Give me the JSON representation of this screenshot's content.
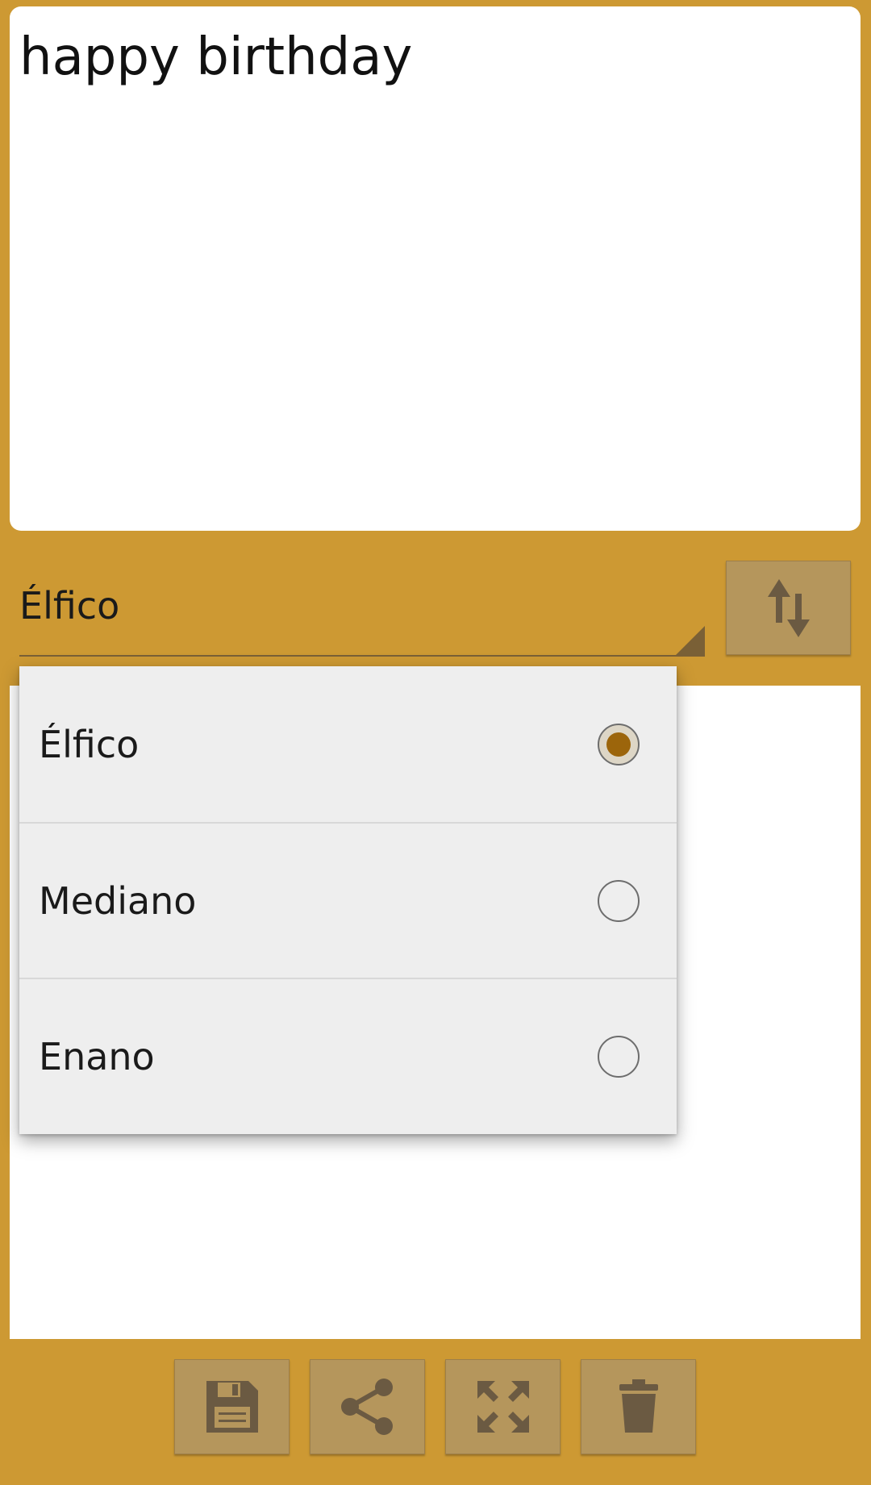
{
  "input": {
    "text": "happy birthday"
  },
  "language_selector": {
    "selected": "Élfico"
  },
  "dropdown": {
    "options": [
      {
        "label": "Élfico",
        "checked": true
      },
      {
        "label": "Mediano",
        "checked": false
      },
      {
        "label": "Enano",
        "checked": false
      }
    ]
  },
  "icons": {
    "swap": "swap-vertical-icon",
    "save": "floppy-disk-icon",
    "share": "share-icon",
    "fullscreen": "fullscreen-icon",
    "delete": "trash-icon"
  },
  "colors": {
    "background": "#CD9933",
    "button": "#B5965C",
    "icon": "#6B5A42",
    "radio_selected": "#9C650B"
  }
}
